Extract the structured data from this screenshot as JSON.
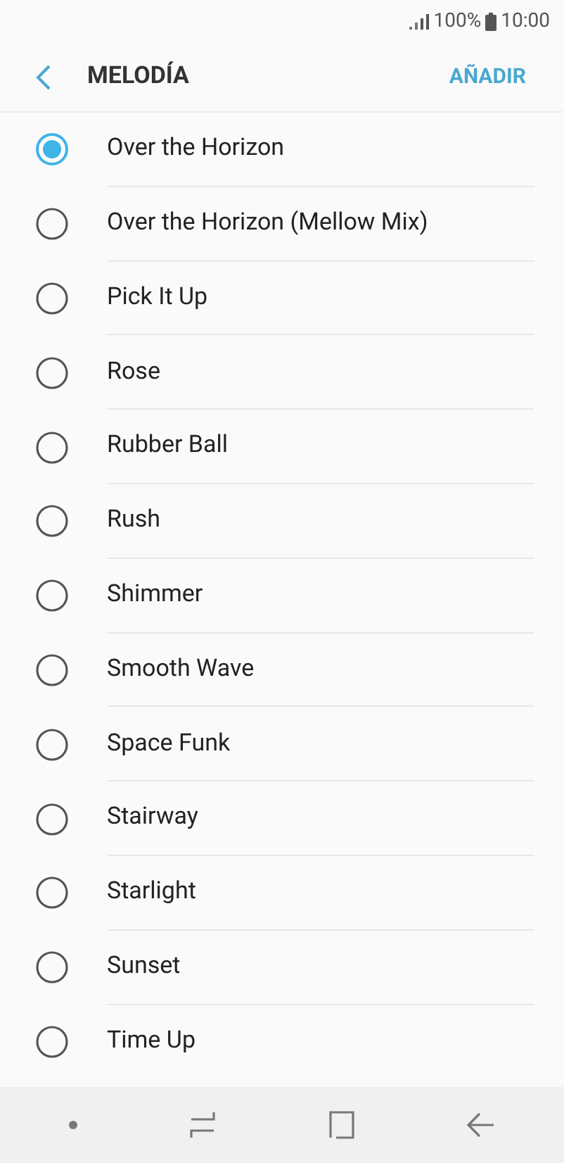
{
  "status_bar": {
    "battery": "100%",
    "time": "10:00"
  },
  "header": {
    "title": "MELODÍA",
    "action": "AÑADIR"
  },
  "ringtones": [
    {
      "label": "Over the Horizon",
      "selected": true
    },
    {
      "label": "Over the Horizon (Mellow Mix)",
      "selected": false
    },
    {
      "label": "Pick It Up",
      "selected": false
    },
    {
      "label": "Rose",
      "selected": false
    },
    {
      "label": "Rubber Ball",
      "selected": false
    },
    {
      "label": "Rush",
      "selected": false
    },
    {
      "label": "Shimmer",
      "selected": false
    },
    {
      "label": "Smooth Wave",
      "selected": false
    },
    {
      "label": "Space Funk",
      "selected": false
    },
    {
      "label": "Stairway",
      "selected": false
    },
    {
      "label": "Starlight",
      "selected": false
    },
    {
      "label": "Sunset",
      "selected": false
    },
    {
      "label": "Time Up",
      "selected": false
    }
  ]
}
